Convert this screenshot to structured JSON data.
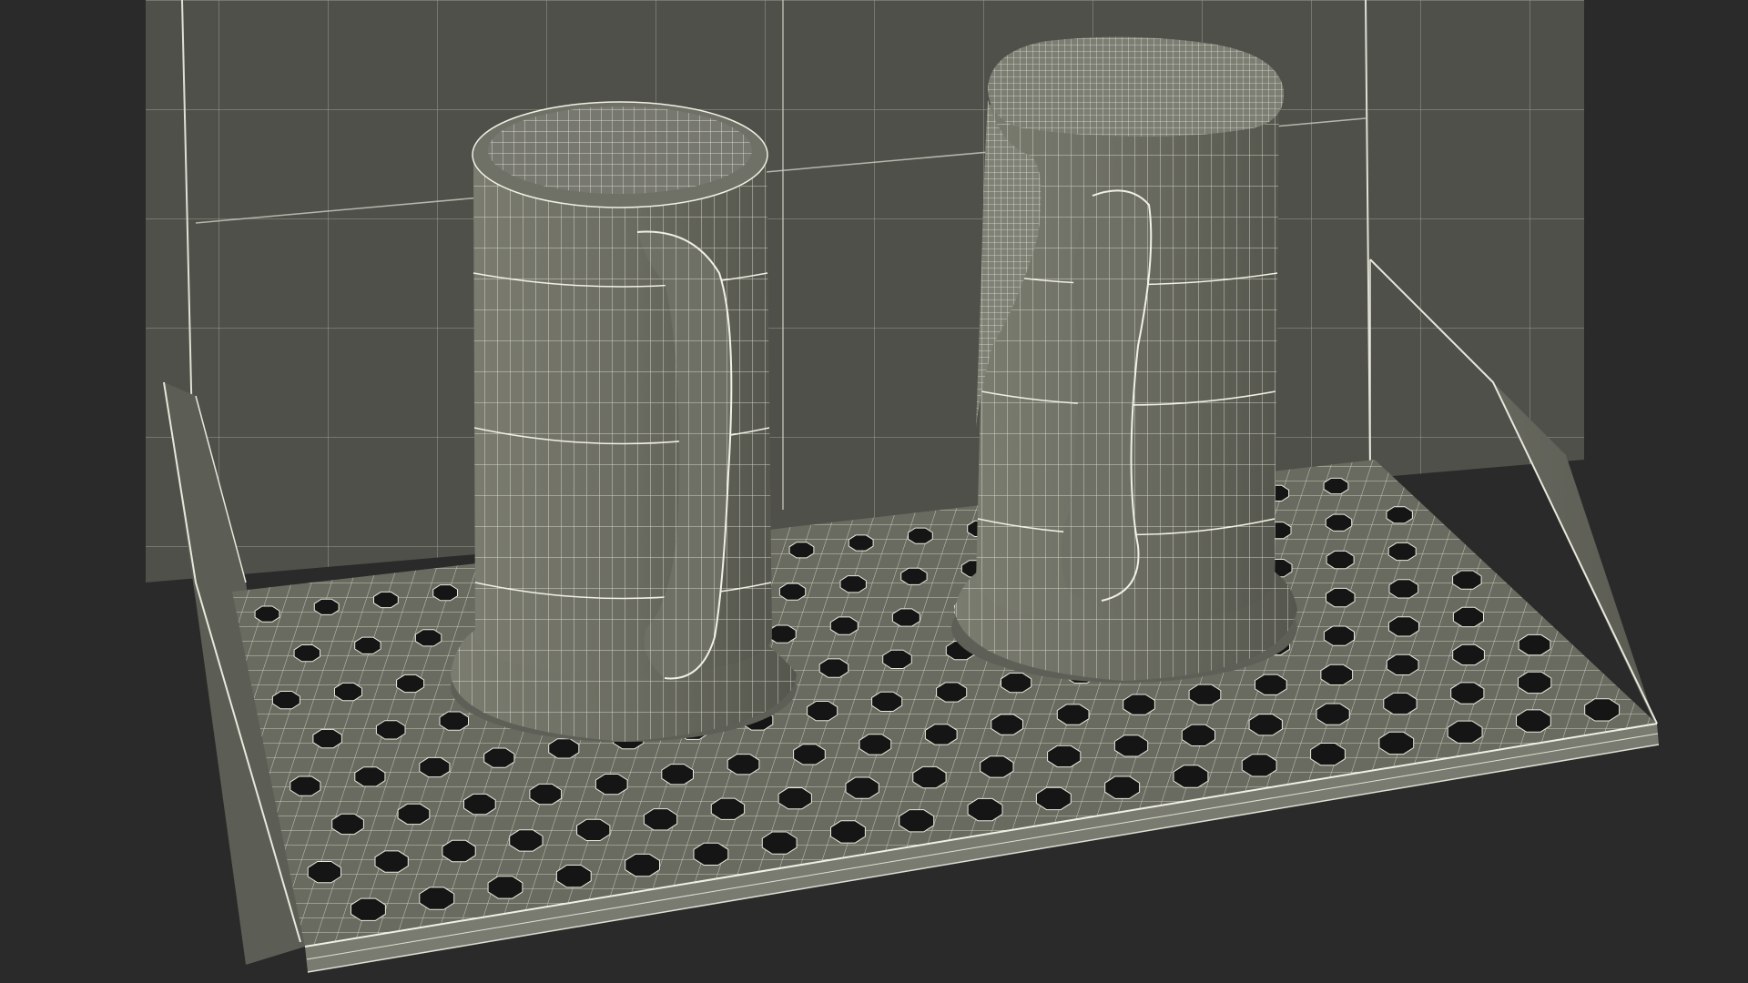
{
  "scene": {
    "background_color": "#2a2a2a",
    "surface_color": "#6a6b60",
    "surface_shadow_color": "#4b4c44",
    "wire_color": "#e8e8dc",
    "hole_color": "#151515",
    "objects": [
      "drip-tray",
      "back-panel",
      "beer-mug-empty",
      "beer-mug-with-foam"
    ]
  }
}
